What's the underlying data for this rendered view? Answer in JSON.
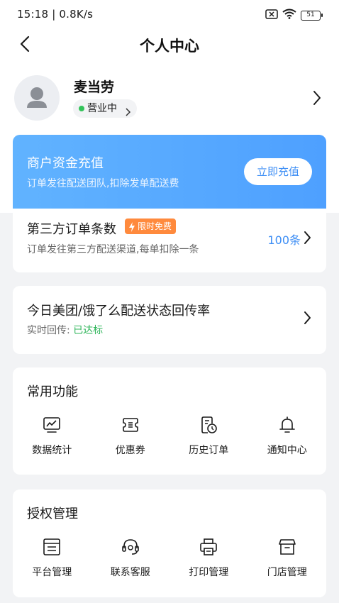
{
  "status_bar": {
    "time": "15:18 | 0.8K/s",
    "battery": "51"
  },
  "nav": {
    "title": "个人中心"
  },
  "profile": {
    "name": "麦当劳",
    "status": "营业中"
  },
  "recharge": {
    "title": "商户资金充值",
    "subtitle": "订单发往配送团队,扣除发单配送费",
    "button": "立即充值"
  },
  "third_party": {
    "title": "第三方订单条数",
    "badge": "限时免费",
    "subtitle": "订单发往第三方配送渠道,每单扣除一条",
    "count": "100条"
  },
  "delivery_rate": {
    "title": "今日美团/饿了么配送状态回传率",
    "label": "实时回传:",
    "value": "已达标"
  },
  "common": {
    "title": "常用功能",
    "items": [
      {
        "label": "数据统计",
        "icon": "chart-monitor-icon"
      },
      {
        "label": "优惠券",
        "icon": "coupon-icon"
      },
      {
        "label": "历史订单",
        "icon": "history-order-icon"
      },
      {
        "label": "通知中心",
        "icon": "bell-icon"
      }
    ]
  },
  "auth": {
    "title": "授权管理",
    "items": [
      {
        "label": "平台管理",
        "icon": "platform-list-icon"
      },
      {
        "label": "联系客服",
        "icon": "headset-icon"
      },
      {
        "label": "打印管理",
        "icon": "printer-icon"
      },
      {
        "label": "门店管理",
        "icon": "store-icon"
      }
    ]
  },
  "colors": {
    "accent": "#3d8ef5",
    "online": "#33c35a",
    "badge": "#ff8a3d",
    "success": "#2fb55a"
  }
}
